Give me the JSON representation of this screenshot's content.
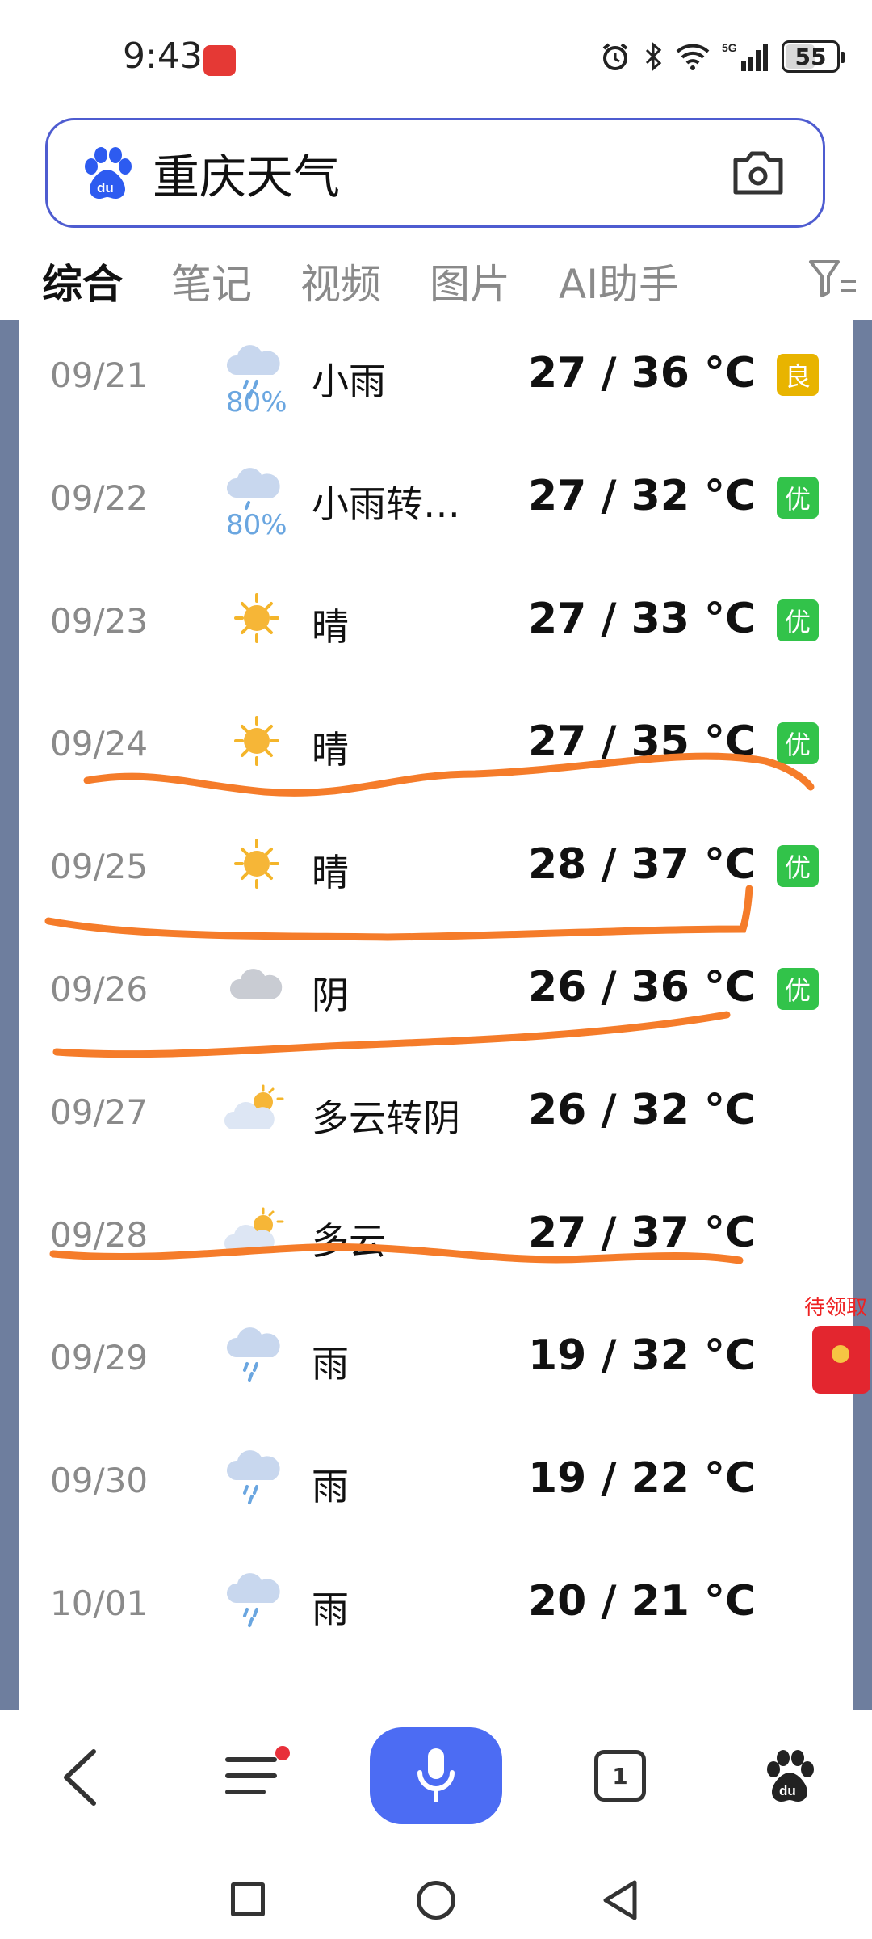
{
  "status_bar": {
    "time": "9:43",
    "battery": "55",
    "battery_level_percent": 55,
    "network": "5G"
  },
  "search": {
    "query": "重庆天气"
  },
  "tabs": [
    {
      "label": "综合",
      "active": true
    },
    {
      "label": "笔记"
    },
    {
      "label": "视频"
    },
    {
      "label": "图片"
    },
    {
      "label": "AI助手"
    }
  ],
  "forecast": [
    {
      "date": "09/21",
      "icon": "rain-icon",
      "precip": "80%",
      "condition": "小雨",
      "temp": "27 / 36 °C",
      "aq": "良",
      "aq_color": "#e8b400"
    },
    {
      "date": "09/22",
      "icon": "rain-cloud-icon",
      "precip": "80%",
      "condition": "小雨转…",
      "temp": "27 / 32 °C",
      "aq": "优",
      "aq_color": "#32c34a"
    },
    {
      "date": "09/23",
      "icon": "sun-icon",
      "precip": "",
      "condition": "晴",
      "temp": "27 / 33 °C",
      "aq": "优",
      "aq_color": "#32c34a"
    },
    {
      "date": "09/24",
      "icon": "sun-icon",
      "precip": "",
      "condition": "晴",
      "temp": "27 / 35 °C",
      "aq": "优",
      "aq_color": "#32c34a"
    },
    {
      "date": "09/25",
      "icon": "sun-icon",
      "precip": "",
      "condition": "晴",
      "temp": "28 / 37 °C",
      "aq": "优",
      "aq_color": "#32c34a"
    },
    {
      "date": "09/26",
      "icon": "cloud-icon",
      "precip": "",
      "condition": "阴",
      "temp": "26 / 36 °C",
      "aq": "优",
      "aq_color": "#32c34a"
    },
    {
      "date": "09/27",
      "icon": "partly-cloudy-icon",
      "precip": "",
      "condition": "多云转阴",
      "temp": "26 / 32 °C",
      "aq": "",
      "aq_color": ""
    },
    {
      "date": "09/28",
      "icon": "partly-cloudy-icon",
      "precip": "",
      "condition": "多云",
      "temp": "27 / 37 °C",
      "aq": "",
      "aq_color": ""
    },
    {
      "date": "09/29",
      "icon": "rain-icon",
      "precip": "",
      "condition": "雨",
      "temp": "19 / 32 °C",
      "aq": "",
      "aq_color": ""
    },
    {
      "date": "09/30",
      "icon": "rain-icon",
      "precip": "",
      "condition": "雨",
      "temp": "19 / 22 °C",
      "aq": "",
      "aq_color": ""
    },
    {
      "date": "10/01",
      "icon": "rain-icon",
      "precip": "",
      "condition": "雨",
      "temp": "20 / 21 °C",
      "aq": "",
      "aq_color": ""
    }
  ],
  "red_packet": {
    "label": "待领取"
  },
  "bottom_nav": {
    "tab_count": "1"
  },
  "colors": {
    "accent": "#4c6cf3",
    "annotation": "#f57c2a"
  }
}
